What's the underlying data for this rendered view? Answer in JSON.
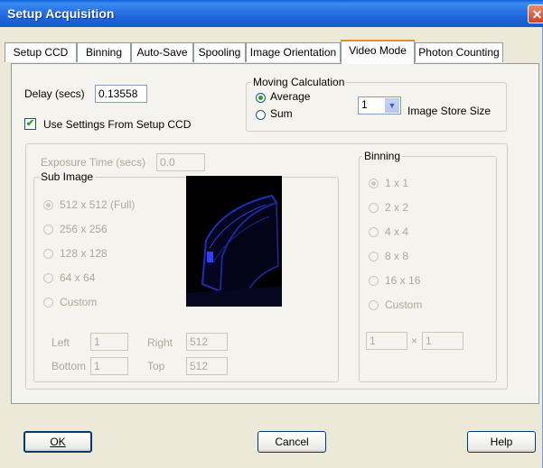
{
  "window": {
    "title": "Setup Acquisition",
    "close_glyph": "✕"
  },
  "tabs": [
    {
      "label": "Setup CCD"
    },
    {
      "label": "Binning"
    },
    {
      "label": "Auto-Save"
    },
    {
      "label": "Spooling"
    },
    {
      "label": "Image Orientation"
    },
    {
      "label": "Video Mode"
    },
    {
      "label": "Photon Counting"
    }
  ],
  "video": {
    "delay_label": "Delay (secs)",
    "delay_value": "0.13558",
    "use_settings_label": "Use Settings From Setup CCD",
    "use_settings_checked": true,
    "moving_calc": {
      "label": "Moving Calculation",
      "options": [
        {
          "label": "Average",
          "selected": true
        },
        {
          "label": "Sum",
          "selected": false
        }
      ]
    },
    "image_store": {
      "value": "1",
      "label": "Image Store Size"
    },
    "exposure_label": "Exposure Time (secs)",
    "exposure_value": "0.0",
    "sub_image": {
      "label": "Sub Image",
      "options": [
        {
          "label": "512 x 512 (Full)",
          "selected": true
        },
        {
          "label": "256 x 256",
          "selected": false
        },
        {
          "label": "128 x 128",
          "selected": false
        },
        {
          "label": "64 x 64",
          "selected": false
        },
        {
          "label": "Custom",
          "selected": false
        }
      ],
      "left_label": "Left",
      "left_value": "1",
      "right_label": "Right",
      "right_value": "512",
      "bottom_label": "Bottom",
      "bottom_value": "1",
      "top_label": "Top",
      "top_value": "512"
    },
    "binning": {
      "label": "Binning",
      "options": [
        {
          "label": "1 x 1",
          "selected": true
        },
        {
          "label": "2 x 2",
          "selected": false
        },
        {
          "label": "4 x 4",
          "selected": false
        },
        {
          "label": "8 x 8",
          "selected": false
        },
        {
          "label": "16 x 16",
          "selected": false
        },
        {
          "label": "Custom",
          "selected": false
        }
      ],
      "custom_x": "1",
      "times": "×",
      "custom_y": "1"
    }
  },
  "buttons": {
    "ok": "OK",
    "cancel": "Cancel",
    "help": "Help"
  }
}
